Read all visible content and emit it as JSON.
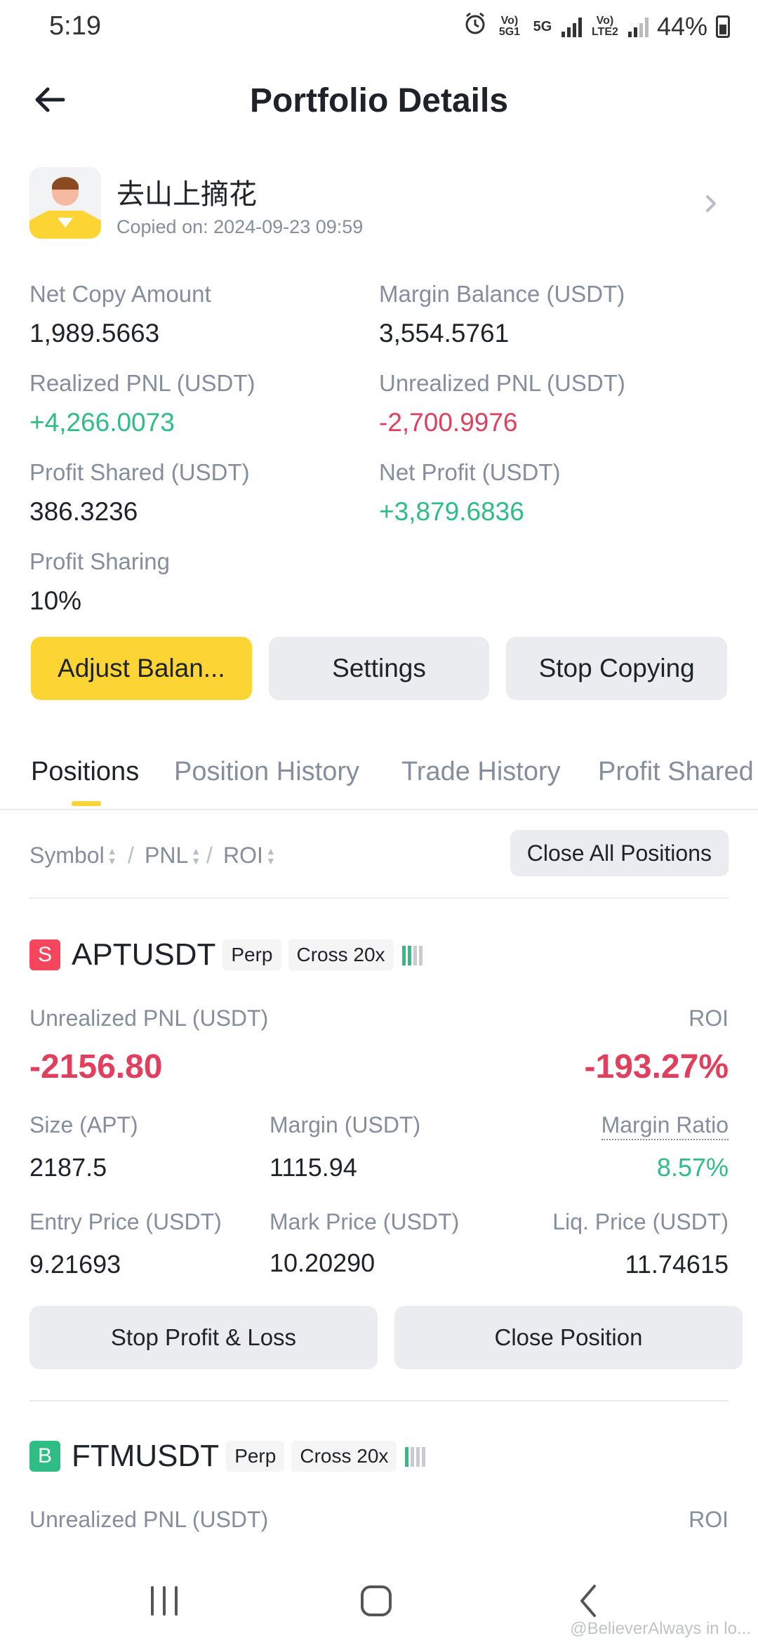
{
  "status_bar": {
    "time": "5:19",
    "net1": "Vo) 5G1",
    "net2": "5G",
    "net3": "Vo) LTE2",
    "battery": "44%"
  },
  "header": {
    "title": "Portfolio Details"
  },
  "trader": {
    "name": "去山上摘花",
    "copied_on": "Copied on: 2024-09-23 09:59"
  },
  "stats": [
    {
      "label": "Net Copy Amount",
      "value": "1,989.5663",
      "color": "neutral"
    },
    {
      "label": "Margin Balance (USDT)",
      "value": "3,554.5761",
      "color": "neutral"
    },
    {
      "label": "Realized PNL (USDT)",
      "value": "+4,266.0073",
      "color": "green"
    },
    {
      "label": "Unrealized PNL (USDT)",
      "value": "-2,700.9976",
      "color": "red"
    },
    {
      "label": "Profit Shared (USDT)",
      "value": "386.3236",
      "color": "neutral"
    },
    {
      "label": "Net Profit (USDT)",
      "value": "+3,879.6836",
      "color": "green"
    },
    {
      "label": "Profit Sharing",
      "value": "10%",
      "color": "neutral"
    }
  ],
  "actions": {
    "adjust": "Adjust Balan...",
    "settings": "Settings",
    "stop": "Stop Copying"
  },
  "tabs": [
    "Positions",
    "Position History",
    "Trade History",
    "Profit Shared"
  ],
  "sort": {
    "symbol": "Symbol",
    "pnl": "PNL",
    "roi": "ROI",
    "separator": "/",
    "close_all": "Close All Positions"
  },
  "positions": [
    {
      "side": "S",
      "symbol": "APTUSDT",
      "type": "Perp",
      "margin_mode": "Cross 20x",
      "unrealized_label": "Unrealized PNL (USDT)",
      "unrealized": "-2156.80",
      "roi_label": "ROI",
      "roi": "-193.27%",
      "size_label": "Size (APT)",
      "size": "2187.5",
      "margin_label": "Margin (USDT)",
      "margin": "1115.94",
      "margin_ratio_label": "Margin Ratio",
      "margin_ratio": "8.57%",
      "entry_label": "Entry Price (USDT)",
      "entry": "9.21693",
      "mark_label": "Mark Price (USDT)",
      "mark": "10.20290",
      "liq_label": "Liq. Price (USDT)",
      "liq": "11.74615",
      "btn_tpsl": "Stop Profit & Loss",
      "btn_close": "Close Position"
    },
    {
      "side": "B",
      "symbol": "FTMUSDT",
      "type": "Perp",
      "margin_mode": "Cross 20x",
      "unrealized_label": "Unrealized PNL (USDT)",
      "roi_label": "ROI"
    }
  ],
  "watermark": "@BelieverAlways in lo...",
  "colors": {
    "accent": "#fcd535",
    "green": "#2ebd85",
    "red": "#e0405e",
    "muted": "#848e9c"
  }
}
